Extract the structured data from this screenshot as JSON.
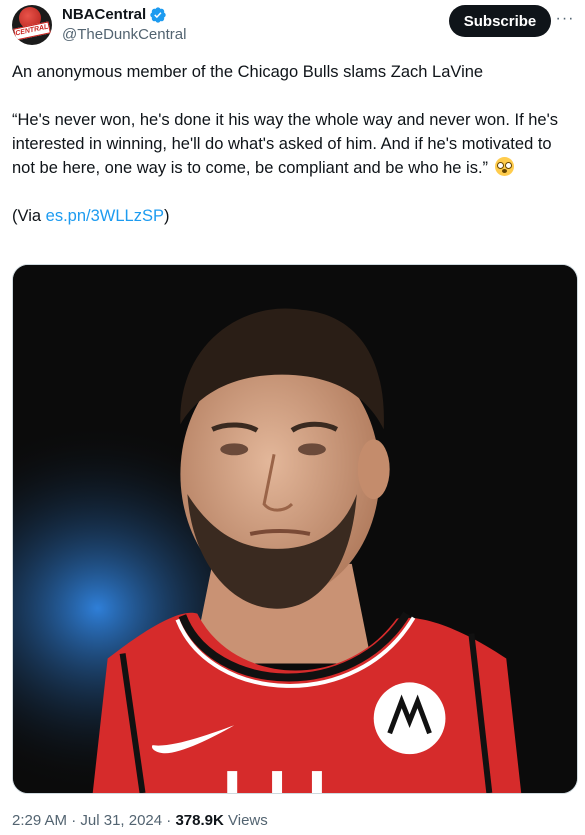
{
  "author": {
    "display_name": "NBACentral",
    "handle": "@TheDunkCentral",
    "avatar_text": "CENTRAL",
    "verified": true
  },
  "actions": {
    "subscribe_label": "Subscribe",
    "more_label": "···"
  },
  "tweet": {
    "headline": "An anonymous member of the Chicago Bulls slams Zach LaVine",
    "quote": "“He's never won, he's done it his way the whole way and never won. If he's interested in winning, he'll do what's asked of him. And if he's motivated to not be here, one way is to come, be compliant and be who he is.”",
    "emoji": "flushed-face",
    "via_prefix": "(Via ",
    "via_link": "es.pn/3WLLzSP",
    "via_suffix": ")"
  },
  "meta": {
    "time": "2:29 AM",
    "separator": " · ",
    "date": "Jul 31, 2024",
    "views_count": "378.9K",
    "views_label": " Views"
  },
  "colors": {
    "link": "#1d9bf0",
    "secondary_text": "#536471",
    "jersey_red": "#d62b2b",
    "button_bg": "#0f1419"
  }
}
